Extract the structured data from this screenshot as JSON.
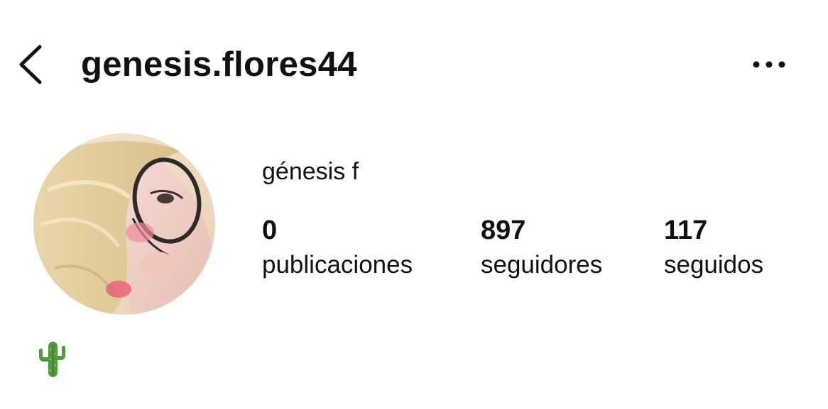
{
  "header": {
    "username": "genesis.flores44",
    "back_icon": "chevron-left-icon",
    "more_icon": "ellipsis-horizontal-icon"
  },
  "profile": {
    "display_name": "génesis f",
    "avatar": "profile-photo-blonde-with-glasses",
    "bio_icon": "cactus-emoji",
    "stats": {
      "posts": {
        "count": "0",
        "label": "publicaciones"
      },
      "followers": {
        "count": "897",
        "label": "seguidores"
      },
      "following": {
        "count": "117",
        "label": "seguidos"
      }
    }
  },
  "colors": {
    "text": "#111111",
    "background": "#ffffff",
    "cactus_green": "#4f9a3c"
  }
}
